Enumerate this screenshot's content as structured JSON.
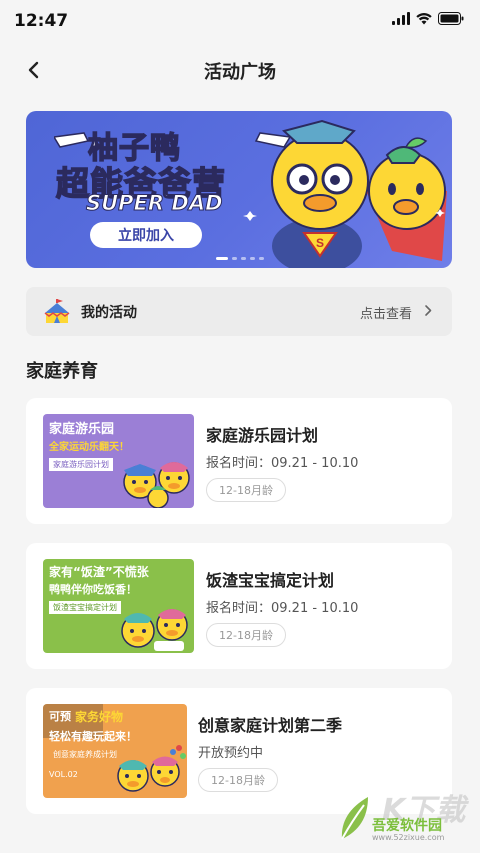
{
  "status": {
    "time": "12:47"
  },
  "nav": {
    "title": "活动广场"
  },
  "banner": {
    "title": "柚子鸭",
    "subtitle": "超能爸爸营",
    "en": "SUPER DAD",
    "button": "立即加入",
    "colors": {
      "background": "#5b6fe0",
      "duck": "#fdd735"
    }
  },
  "my_activity": {
    "label": "我的活动",
    "more": "点击查看"
  },
  "section": {
    "title": "家庭养育"
  },
  "cards": [
    {
      "title": "家庭游乐园计划",
      "date": "报名时间：09.21 - 10.10",
      "tag": "12-18月龄",
      "thumb": {
        "line1": "家庭游乐园",
        "line2": "全家运动乐翻天！",
        "box": "家庭游乐园计划",
        "color": "#9b7fd6"
      }
    },
    {
      "title": "饭渣宝宝搞定计划",
      "date": "报名时间：09.21 - 10.10",
      "tag": "12-18月龄",
      "thumb": {
        "line1": "家有“饭渣”不慌张",
        "line2": "鸭鸭伴你吃饭香！",
        "box": "饭渣宝宝搞定计划",
        "color": "#8ac04a"
      }
    },
    {
      "title": "创意家庭计划第二季",
      "date": "开放预约中",
      "tag": "12-18月龄",
      "thumb": {
        "badge": "可预",
        "line1": "家务好物",
        "line2": "轻松有趣玩起来！",
        "box": "创意家庭养成计划",
        "vol": "VOL.02",
        "color": "#f0a14e"
      }
    }
  ],
  "watermark": {
    "big": "K下载",
    "name": "吾爱软件园",
    "url": "www.52zixue.com"
  }
}
